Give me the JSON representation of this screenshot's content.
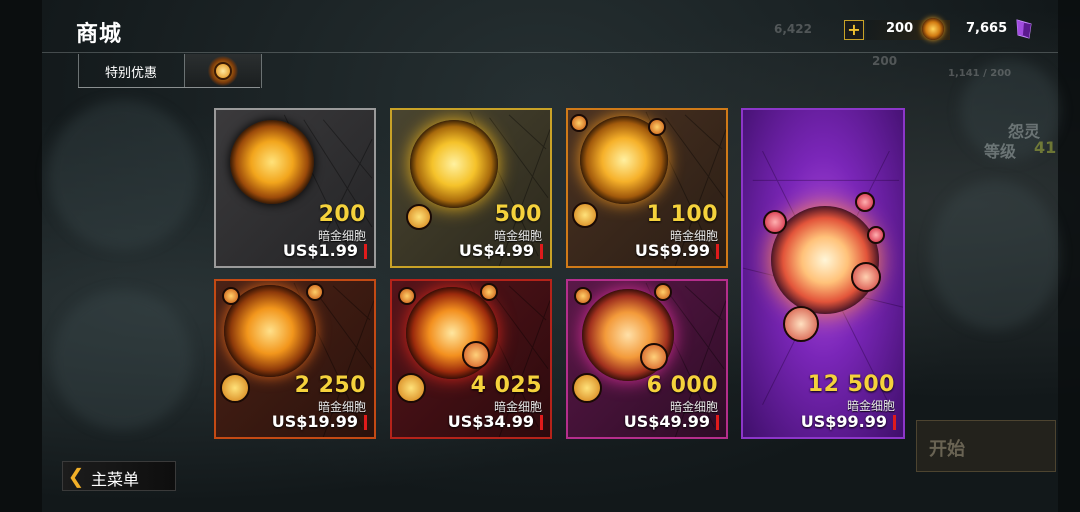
{
  "header": {
    "title": "商城",
    "tabs": [
      {
        "label": "特别优惠"
      },
      {
        "icon": "dark-gold-cell-icon"
      }
    ]
  },
  "currency": {
    "ghost_left": "6,422",
    "ghost_right": "200",
    "ghost_small": "1,141 / 200",
    "gold_cells": "200",
    "gold_icon": "dark-gold-cell-icon",
    "gems": "7,665",
    "gem_icon": "purple-gem-icon"
  },
  "side": {
    "name": "怨灵",
    "level_label": "等级",
    "level": "41",
    "start_label": "开始"
  },
  "cards": [
    {
      "amount": "200",
      "unit": "暗金细胞",
      "price": "US$1.99",
      "border": "#9a9a9a",
      "glow": "#e6a21d"
    },
    {
      "amount": "500",
      "unit": "暗金细胞",
      "price": "US$4.99",
      "border": "#c9a227",
      "glow": "#f0b92a"
    },
    {
      "amount": "1 100",
      "unit": "暗金细胞",
      "price": "US$9.99",
      "border": "#d07a18",
      "glow": "#f0a023"
    },
    {
      "amount": "2 250",
      "unit": "暗金细胞",
      "price": "US$19.99",
      "border": "#c44a14",
      "glow": "#e58a1a"
    },
    {
      "amount": "4 025",
      "unit": "暗金细胞",
      "price": "US$34.99",
      "border": "#b5231a",
      "glow": "#ef7a1c"
    },
    {
      "amount": "6 000",
      "unit": "暗金细胞",
      "price": "US$49.99",
      "border": "#b52e8c",
      "glow": "#f08a2a"
    },
    {
      "amount": "12 500",
      "unit": "暗金细胞",
      "price": "US$99.99",
      "border": "#8c36c9",
      "glow": "#ffb57a"
    }
  ],
  "footer": {
    "back_label": "主菜单"
  }
}
